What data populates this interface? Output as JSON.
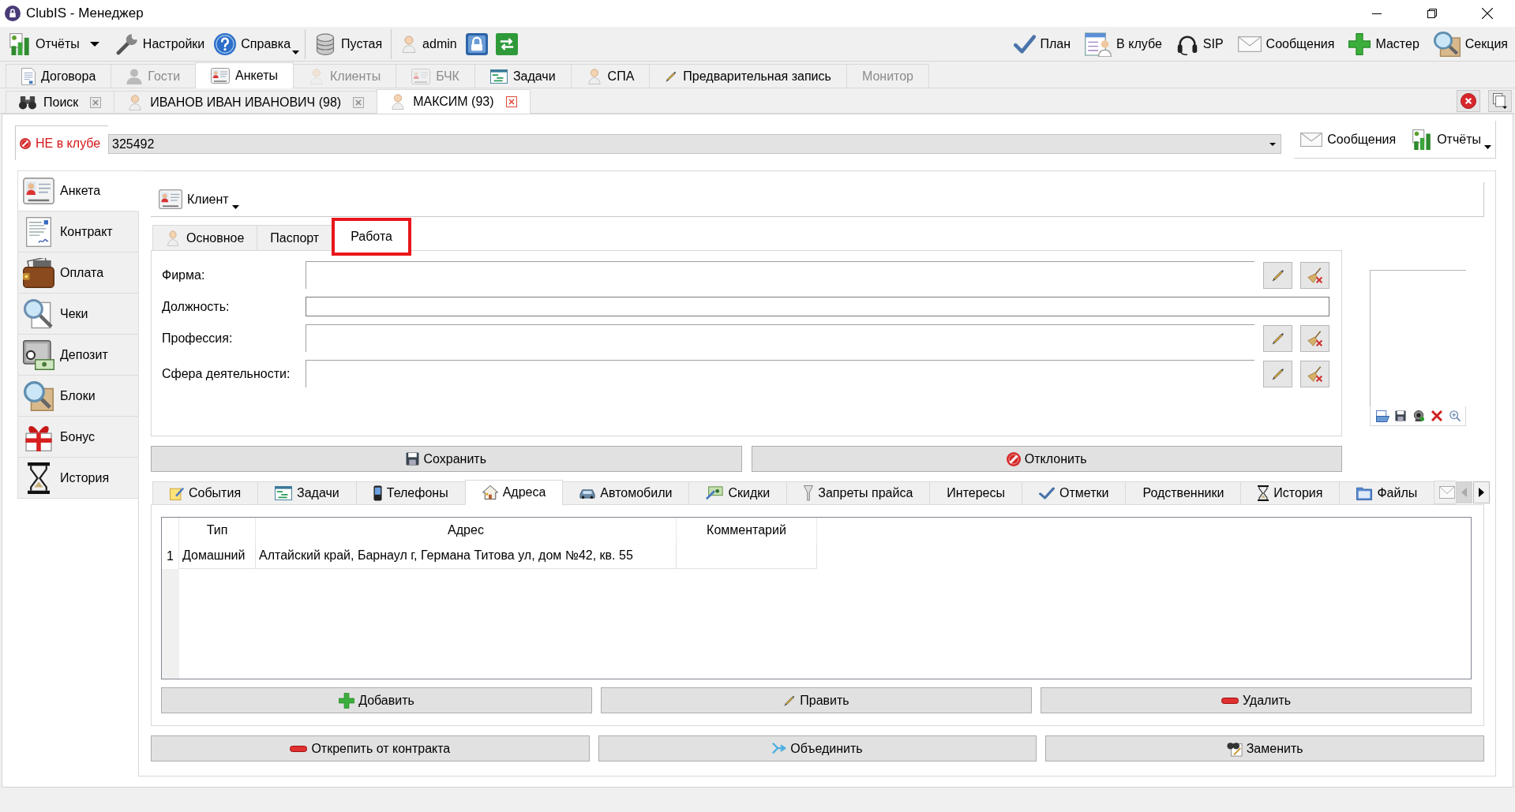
{
  "window": {
    "title": "ClubIS - Менеджер"
  },
  "toolbar": {
    "left": [
      [
        {
          "kind": "split",
          "label": "Отчёты"
        },
        {
          "kind": "plain",
          "label": "Настройки"
        },
        {
          "kind": "menu",
          "label": "Справка"
        }
      ],
      [
        {
          "kind": "plain",
          "label": "Пустая"
        }
      ],
      [
        {
          "kind": "plain",
          "label": "admin"
        },
        {
          "kind": "icon"
        },
        {
          "kind": "icon"
        }
      ]
    ],
    "right": [
      {
        "label": "План"
      },
      {
        "label": "В клубе"
      },
      {
        "label": "SIP"
      },
      {
        "label": "Сообщения"
      },
      {
        "label": "Мастер"
      },
      {
        "label": "Секция"
      }
    ]
  },
  "main_tabs": [
    {
      "label": "Договора",
      "selected": false,
      "disabled": false
    },
    {
      "label": "Гости",
      "selected": false,
      "disabled": true
    },
    {
      "label": "Анкеты",
      "selected": true,
      "disabled": false
    },
    {
      "label": "Клиенты",
      "selected": false,
      "disabled": true
    },
    {
      "label": "БЧК",
      "selected": false,
      "disabled": true
    },
    {
      "label": "Задачи",
      "selected": false,
      "disabled": false
    },
    {
      "label": "СПА",
      "selected": false,
      "disabled": false
    },
    {
      "label": "Предварительная запись",
      "selected": false,
      "disabled": false
    },
    {
      "label": "Монитор",
      "selected": false,
      "disabled": true
    }
  ],
  "document_tabs": [
    {
      "label": "Поиск",
      "selected": false
    },
    {
      "label": "ИВАНОВ ИВАН ИВАНОВИЧ (98)",
      "selected": false
    },
    {
      "label": "МАКСИМ (93)",
      "selected": true
    }
  ],
  "client_bar": {
    "status": {
      "label": "НЕ в клубе",
      "in_club": false
    },
    "card": {
      "value": "325492"
    },
    "buttons": [
      {
        "label": "Сообщения",
        "arrow": false
      },
      {
        "label": "Отчёты",
        "arrow": true
      }
    ]
  },
  "sidebar": {
    "items": [
      {
        "label": "Анкета",
        "selected": true
      },
      {
        "label": "Контракт",
        "selected": false
      },
      {
        "label": "Оплата",
        "selected": false
      },
      {
        "label": "Чеки",
        "selected": false
      },
      {
        "label": "Депозит",
        "selected": false
      },
      {
        "label": "Блоки",
        "selected": false
      },
      {
        "label": "Бонус",
        "selected": false
      },
      {
        "label": "История",
        "selected": false
      }
    ]
  },
  "client_menu": {
    "label": "Клиент"
  },
  "form_tabs": [
    {
      "label": "Основное",
      "selected": false,
      "highlighted": false
    },
    {
      "label": "Паспорт",
      "selected": false,
      "highlighted": false
    },
    {
      "label": "Работа",
      "selected": true,
      "highlighted": true
    }
  ],
  "fields": [
    {
      "label": "Фирма:",
      "kind": "picker"
    },
    {
      "label": "Должность:",
      "kind": "text"
    },
    {
      "label": "Профессия:",
      "kind": "picker"
    },
    {
      "label": "Сфера деятельности:",
      "kind": "picker"
    }
  ],
  "form_buttons": [
    "Сохранить",
    "Отклонить"
  ],
  "detail_tabs": {
    "items": [
      {
        "label": "События",
        "selected": false
      },
      {
        "label": "Задачи",
        "selected": false
      },
      {
        "label": "Телефоны",
        "selected": false
      },
      {
        "label": "Адреса",
        "selected": true
      },
      {
        "label": "Автомобили",
        "selected": false
      },
      {
        "label": "Скидки",
        "selected": false
      },
      {
        "label": "Запреты прайса",
        "selected": false
      },
      {
        "label": "Интересы",
        "selected": false
      },
      {
        "label": "Отметки",
        "selected": false
      },
      {
        "label": "Родственники",
        "selected": false
      },
      {
        "label": "История",
        "selected": false
      },
      {
        "label": "Файлы",
        "selected": false
      }
    ],
    "scroll": {
      "back_enabled": false,
      "forward_enabled": true
    }
  },
  "table": {
    "columns": [
      "Тип",
      "Адрес",
      "Комментарий"
    ],
    "rows": [
      {
        "number": "1",
        "cells": [
          "Домашний",
          "Алтайский край, Барнаул г, Германа Титова ул, дом №42, кв. 55"
        ]
      }
    ]
  },
  "table_buttons": [
    "Добавить",
    "Править",
    "Удалить"
  ],
  "bottom_buttons": [
    "Открепить от контракта",
    "Объединить",
    "Заменить"
  ]
}
